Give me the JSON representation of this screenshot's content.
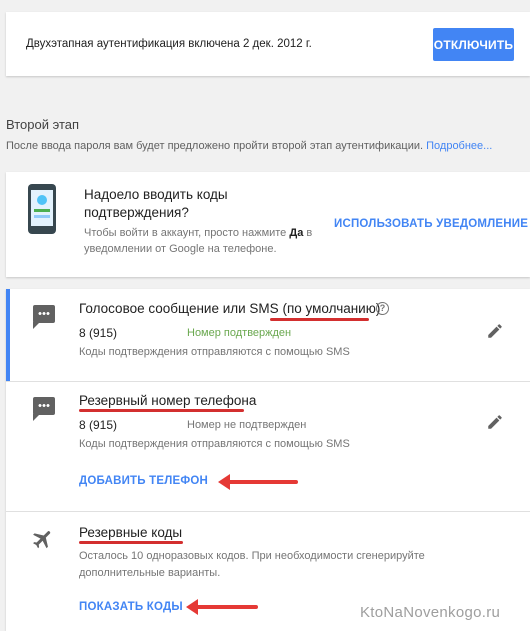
{
  "status": {
    "text": "Двухэтапная аутентификация включена 2 дек. 2012 г.",
    "disable_button": "ОТКЛЮЧИТЬ"
  },
  "second_step": {
    "heading": "Второй этап",
    "description": "После ввода пароля вам будет предложено пройти второй этап аутентификации.",
    "more_link": "Подробнее..."
  },
  "notification_card": {
    "title_line1": "Надоело вводить коды",
    "title_line2": "подтверждения?",
    "desc_part1": "Чтобы войти в аккаунт, просто нажмите",
    "desc_bold": "Да",
    "desc_part2": "в",
    "desc_line2": "уведомлении от Google на телефоне.",
    "action": "ИСПОЛЬЗОВАТЬ УВЕДОМЛЕНИЕ"
  },
  "voice_sms": {
    "title": "Голосовое сообщение или SMS",
    "default_tag": "(по умолчанию)",
    "phone": "8 (915)",
    "status": "Номер подтвержден",
    "note": "Коды подтверждения отправляются с помощью SMS",
    "help_icon": "help-circle-icon",
    "edit_icon": "pencil-icon"
  },
  "backup_phone": {
    "title": "Резервный номер телефона",
    "phone": "8 (915)",
    "status": "Номер не подтвержден",
    "note": "Коды подтверждения отправляются с помощью SMS",
    "add_link": "ДОБАВИТЬ ТЕЛЕФОН",
    "edit_icon": "pencil-icon"
  },
  "backup_codes": {
    "title": "Резервные коды",
    "note_line1": "Осталось 10 одноразовых кодов. При необходимости сгенерируйте",
    "note_line2": "дополнительные варианты.",
    "show_link": "ПОКАЗАТЬ КОДЫ"
  },
  "watermark": "KtoNaNovenkogo.ru",
  "colors": {
    "accent": "#4285f4",
    "verified": "#6aa84f",
    "annotation": "#d32f2f",
    "selected_bar": "#4285f4"
  }
}
